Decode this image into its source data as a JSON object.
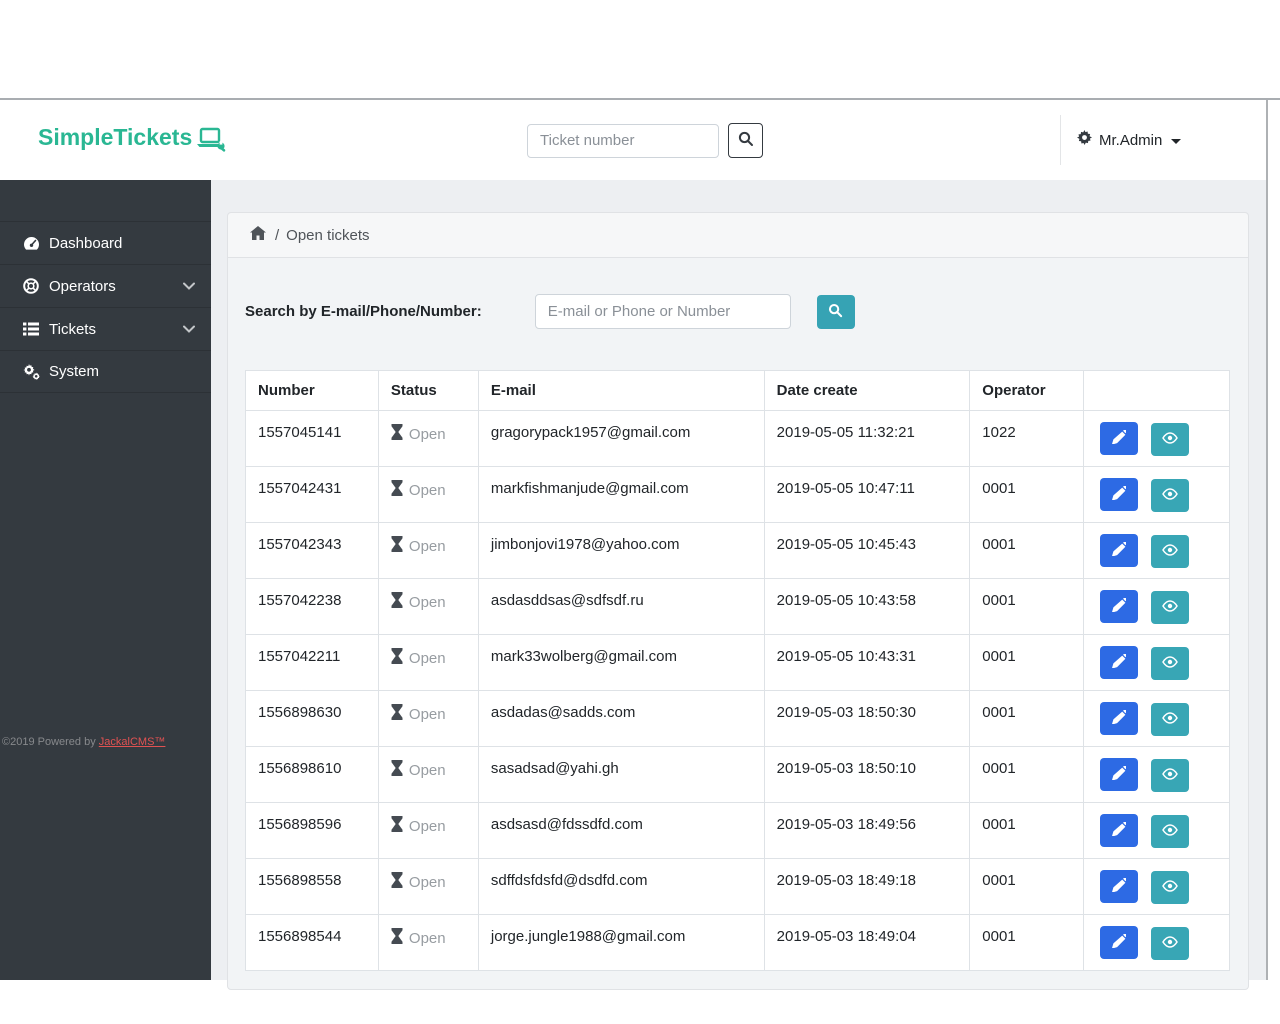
{
  "brand": {
    "name": "SimpleTickets"
  },
  "header": {
    "ticket_search_placeholder": "Ticket number",
    "user_name": "Mr.Admin"
  },
  "sidebar": {
    "items": [
      {
        "label": "Dashboard",
        "icon": "tachometer-icon",
        "expandable": false
      },
      {
        "label": "Operators",
        "icon": "life-ring-icon",
        "expandable": true
      },
      {
        "label": "Tickets",
        "icon": "list-icon",
        "expandable": true
      },
      {
        "label": "System",
        "icon": "cogs-icon",
        "expandable": false
      }
    ],
    "footer": {
      "copyright": "©2019 Powered by",
      "link_label": "JackalCMS™"
    }
  },
  "breadcrumb": {
    "separator": "/",
    "current": "Open tickets"
  },
  "search_panel": {
    "label": "Search by E-mail/Phone/Number:",
    "placeholder": "E-mail or Phone or Number"
  },
  "table": {
    "columns": [
      "Number",
      "Status",
      "E-mail",
      "Date create",
      "Operator",
      ""
    ],
    "rows": [
      {
        "number": "1557045141",
        "status": "Open",
        "email": "gragorypack1957@gmail.com",
        "date": "2019-05-05 11:32:21",
        "operator": "1022"
      },
      {
        "number": "1557042431",
        "status": "Open",
        "email": "markfishmanjude@gmail.com",
        "date": "2019-05-05 10:47:11",
        "operator": "0001"
      },
      {
        "number": "1557042343",
        "status": "Open",
        "email": "jimbonjovi1978@yahoo.com",
        "date": "2019-05-05 10:45:43",
        "operator": "0001"
      },
      {
        "number": "1557042238",
        "status": "Open",
        "email": "asdasddsas@sdfsdf.ru",
        "date": "2019-05-05 10:43:58",
        "operator": "0001"
      },
      {
        "number": "1557042211",
        "status": "Open",
        "email": "mark33wolberg@gmail.com",
        "date": "2019-05-05 10:43:31",
        "operator": "0001"
      },
      {
        "number": "1556898630",
        "status": "Open",
        "email": "asdadas@sadds.com",
        "date": "2019-05-03 18:50:30",
        "operator": "0001"
      },
      {
        "number": "1556898610",
        "status": "Open",
        "email": "sasadsad@yahi.gh",
        "date": "2019-05-03 18:50:10",
        "operator": "0001"
      },
      {
        "number": "1556898596",
        "status": "Open",
        "email": "asdsasd@fdssdfd.com",
        "date": "2019-05-03 18:49:56",
        "operator": "0001"
      },
      {
        "number": "1556898558",
        "status": "Open",
        "email": "sdffdsfdsfd@dsdfd.com",
        "date": "2019-05-03 18:49:18",
        "operator": "0001"
      },
      {
        "number": "1556898544",
        "status": "Open",
        "email": "jorge.jungle1988@gmail.com",
        "date": "2019-05-03 18:49:04",
        "operator": "0001"
      }
    ]
  },
  "colors": {
    "brand_teal": "#2ab793",
    "sidebar_bg": "#343a40",
    "edit_button_blue": "#2d6ae4",
    "view_button_teal": "#38a6b5",
    "search_button_teal": "#36a3b4",
    "status_text_gray": "#979ca1",
    "link_red": "#e05252"
  }
}
